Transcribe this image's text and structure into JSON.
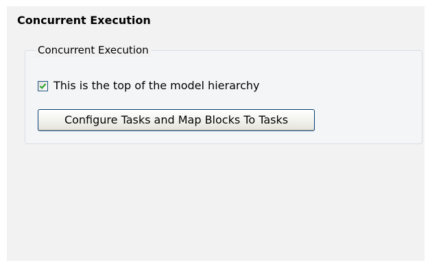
{
  "pane": {
    "title": "Concurrent Execution"
  },
  "group": {
    "legend": "Concurrent Execution",
    "checkbox": {
      "label": "This is the top of the model hierarchy",
      "checked": true
    },
    "button": {
      "label": "Configure Tasks and Map Blocks To Tasks"
    }
  }
}
